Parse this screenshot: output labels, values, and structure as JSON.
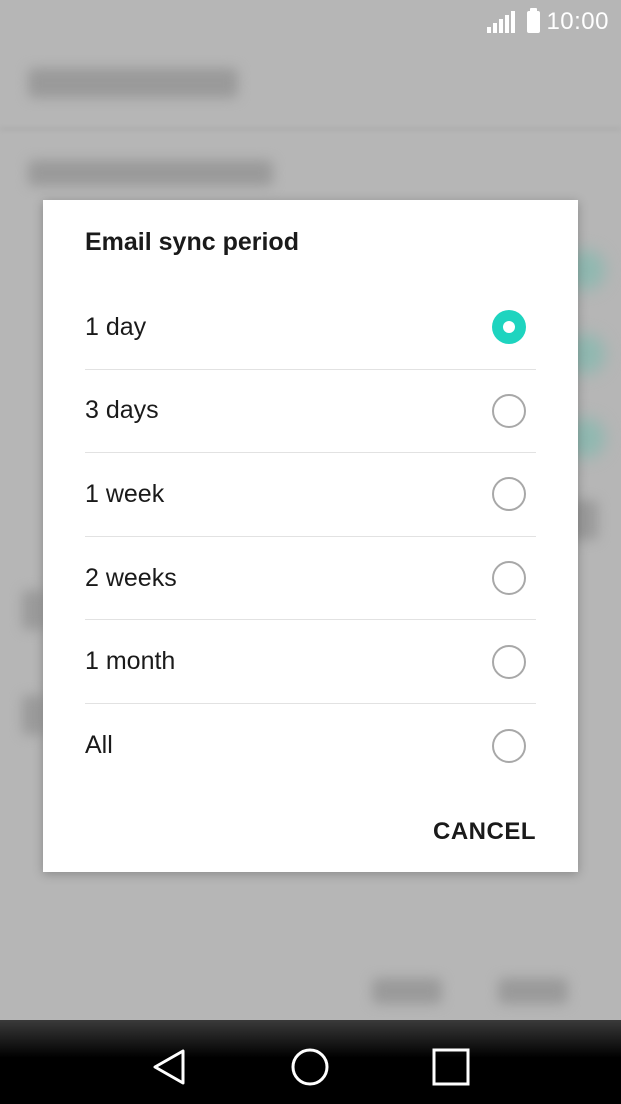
{
  "status_bar": {
    "time": "10:00",
    "icons": [
      "signal-icon",
      "battery-icon"
    ]
  },
  "dialog": {
    "title": "Email sync period",
    "options": [
      {
        "label": "1 day",
        "selected": true
      },
      {
        "label": "3 days",
        "selected": false
      },
      {
        "label": "1 week",
        "selected": false
      },
      {
        "label": "2 weeks",
        "selected": false
      },
      {
        "label": "1 month",
        "selected": false
      },
      {
        "label": "All",
        "selected": false
      }
    ],
    "cancel_label": "CANCEL"
  },
  "nav_bar": {
    "icons": [
      "back-icon",
      "home-icon",
      "recents-icon"
    ]
  },
  "colors": {
    "accent": "#1ed4bf",
    "scrim": "#b3b3b3",
    "dialog_bg": "#ffffff"
  }
}
